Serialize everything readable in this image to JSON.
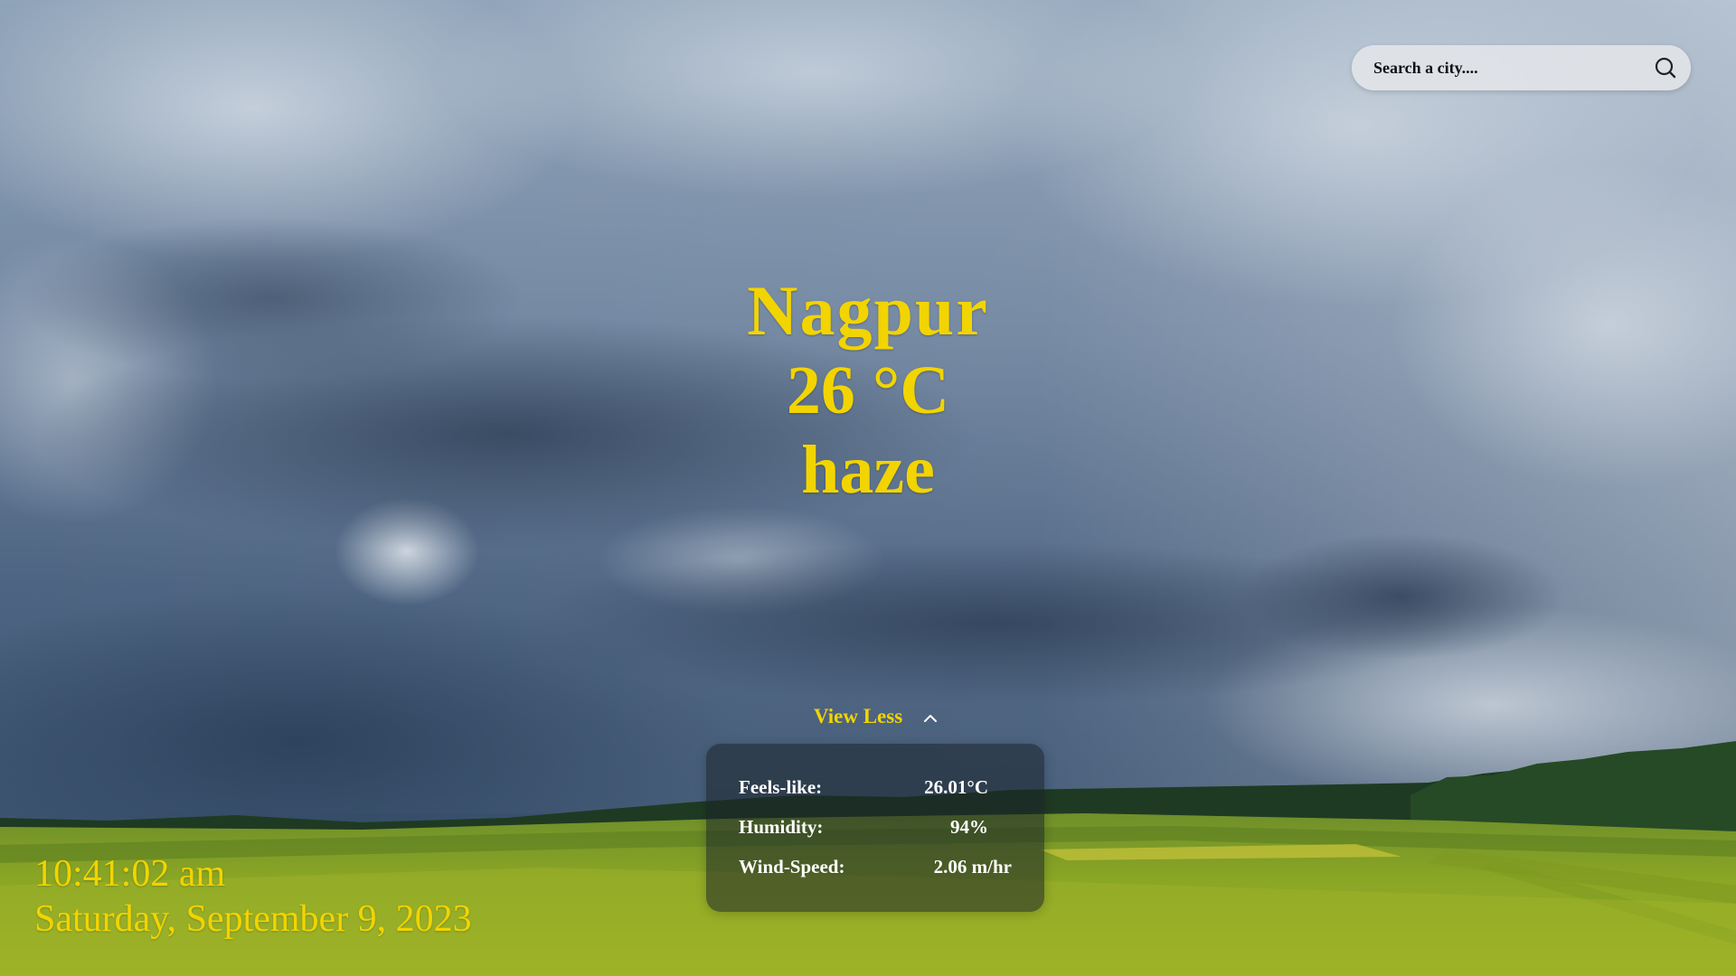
{
  "search": {
    "placeholder": "Search a city...."
  },
  "weather": {
    "city": "Nagpur",
    "temperature": "26 °C",
    "description": "haze"
  },
  "toggle": {
    "label": "View Less"
  },
  "details": {
    "feels_like": {
      "label": "Feels-like:",
      "value": "26.01°C"
    },
    "humidity": {
      "label": "Humidity:",
      "value": "94%"
    },
    "wind_speed": {
      "label": "Wind-Speed:",
      "value": "2.06 m/hr"
    }
  },
  "datetime": {
    "time": "10:41:02 am",
    "date": "Saturday, September 9, 2023"
  },
  "icons": {
    "search": "search-icon",
    "toggle": "chevron-up-icon"
  },
  "colors": {
    "accent": "#f2d400",
    "card_text": "#ffffff",
    "card_bg": "rgba(25,35,40,0.55)"
  }
}
